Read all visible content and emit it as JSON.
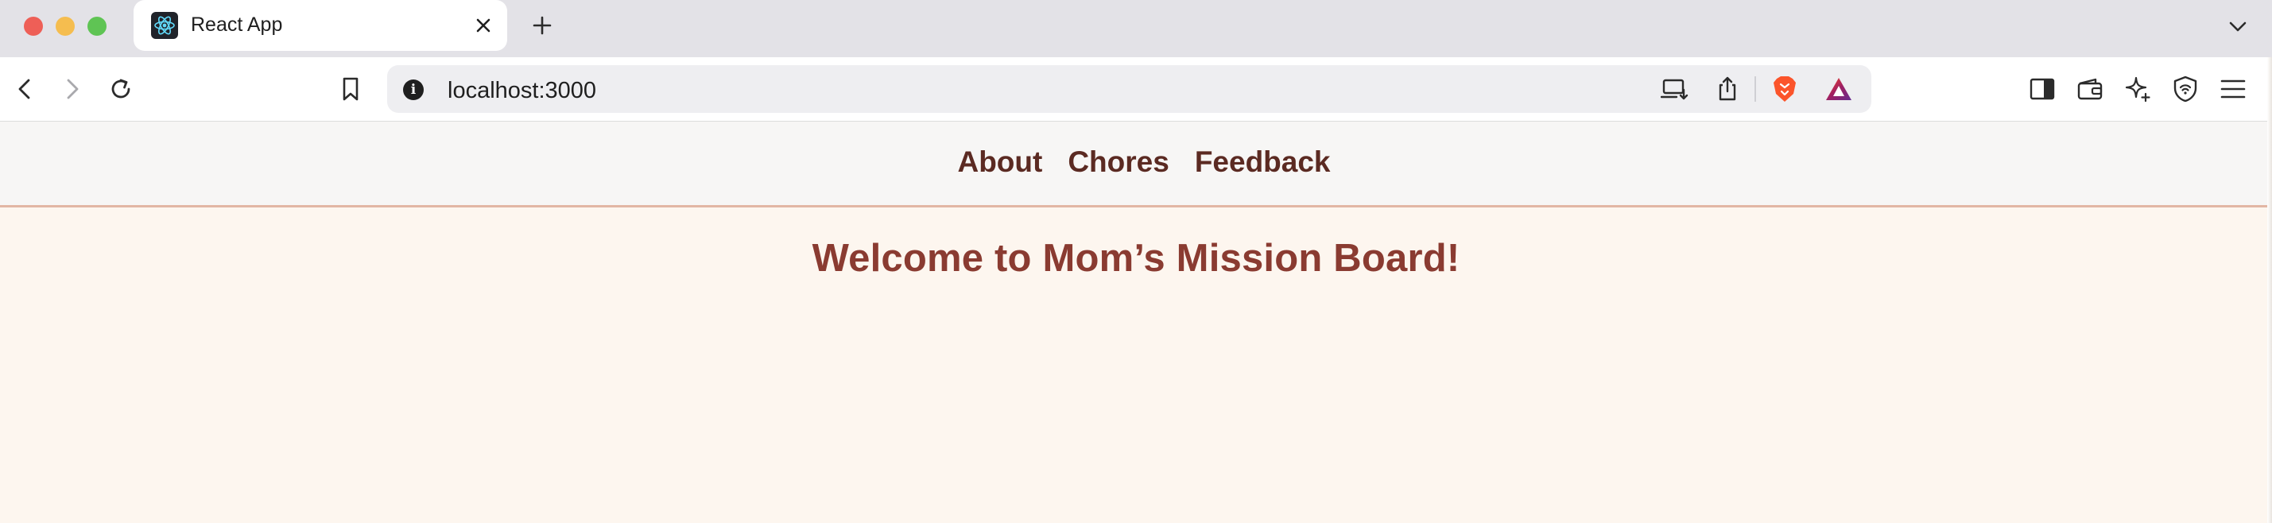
{
  "browser": {
    "tab": {
      "title": "React App",
      "favicon": "react-logo-icon"
    },
    "url": "localhost:3000",
    "toolbar_icons": [
      "back-icon",
      "forward-icon",
      "reload-icon",
      "bookmark-icon",
      "site-info-icon",
      "install-app-icon",
      "share-icon",
      "brave-shields-icon",
      "brave-rewards-icon",
      "sidebar-icon",
      "wallet-icon",
      "leo-ai-icon",
      "vpn-icon",
      "menu-icon"
    ]
  },
  "app": {
    "nav": {
      "items": [
        {
          "label": "About"
        },
        {
          "label": "Chores"
        },
        {
          "label": "Feedback"
        }
      ]
    },
    "heading": "Welcome to Mom’s Mission Board!"
  },
  "colors": {
    "nav_text": "#5b2a22",
    "heading": "#8a3b31",
    "page_bg": "#fdf6ef",
    "nav_bg": "#f7f6f5",
    "nav_border": "#e2b6a4"
  }
}
